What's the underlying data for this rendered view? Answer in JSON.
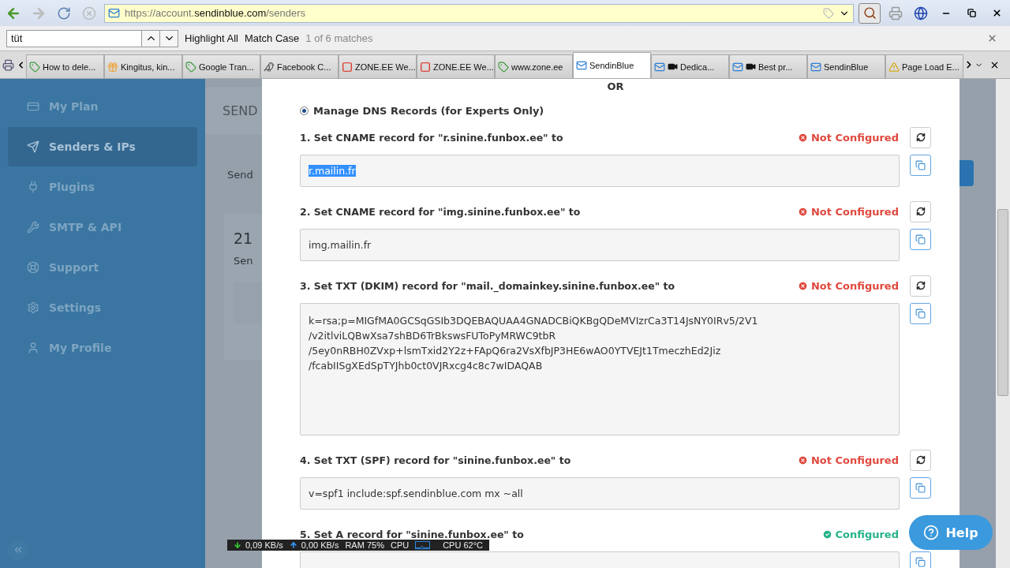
{
  "url": {
    "prefix": "https://account.",
    "domain": "sendinblue.com",
    "path": "/senders"
  },
  "find_bar": {
    "value": "tüt",
    "highlight_all": "Highlight All",
    "match_case": "Match Case",
    "result": "1 of 6 matches"
  },
  "tabs": [
    {
      "label": "How to dele...",
      "selected": false
    },
    {
      "label": "Kingitus, kin...",
      "selected": false
    },
    {
      "label": "Google Tran...",
      "selected": false
    },
    {
      "label": "Facebook C...",
      "selected": false
    },
    {
      "label": "ZONE.EE We...",
      "selected": false
    },
    {
      "label": "ZONE.EE We...",
      "selected": false
    },
    {
      "label": "www.zone.ee",
      "selected": false
    },
    {
      "label": "SendinBlue",
      "selected": true
    },
    {
      "label": "Dedica...",
      "selected": false
    },
    {
      "label": "Best pr...",
      "selected": false
    },
    {
      "label": "SendinBlue",
      "selected": false
    },
    {
      "label": "Page Load E...",
      "selected": false
    }
  ],
  "sidebar": {
    "items": [
      {
        "label": "My Plan",
        "selected": false
      },
      {
        "label": "Senders & IPs",
        "selected": true
      },
      {
        "label": "Plugins",
        "selected": false
      },
      {
        "label": "SMTP & API",
        "selected": false
      },
      {
        "label": "Support",
        "selected": false
      },
      {
        "label": "Settings",
        "selected": false
      },
      {
        "label": "My Profile",
        "selected": false
      }
    ]
  },
  "background": {
    "header": "SEND",
    "label": "Send",
    "count": "21",
    "caption": "Sen"
  },
  "modal": {
    "separator": "OR",
    "option": {
      "label": "Manage DNS Records (for Experts Only)",
      "selected": true
    },
    "records": [
      {
        "title": "1. Set CNAME record for \"r.sinine.funbox.ee\" to",
        "status": "Not Configured",
        "configured": false,
        "value": "r.mailin.fr",
        "value_selected": true,
        "kind": "line"
      },
      {
        "title": "2. Set CNAME record for \"img.sinine.funbox.ee\" to",
        "status": "Not Configured",
        "configured": false,
        "value": "img.mailin.fr",
        "value_selected": false,
        "kind": "line"
      },
      {
        "title": "3. Set TXT (DKIM) record for \"mail._domainkey.sinine.funbox.ee\" to",
        "status": "Not Configured",
        "configured": false,
        "value": "k=rsa;p=MIGfMA0GCSqGSIb3DQEBAQUAA4GNADCBiQKBgQDeMVIzrCa3T14JsNY0IRv5/2V1\n/v2itlviLQBwXsa7shBD6TrBkswsFUToPyMRWC9tbR\n/5ey0nRBH0ZVxp+lsmTxid2Y2z+FApQ6ra2VsXfbJP3HE6wAO0YTVEJt1TmeczhEd2Jiz\n/fcabIISgXEdSpTYJhb0ct0VJRxcg4c8c7wIDAQAB",
        "value_selected": false,
        "kind": "area"
      },
      {
        "title": "4. Set TXT (SPF) record for \"sinine.funbox.ee\" to",
        "status": "Not Configured",
        "configured": false,
        "value": "v=spf1 include:spf.sendinblue.com mx ~all",
        "value_selected": false,
        "kind": "line"
      },
      {
        "title": "5. Set A record for \"sinine.funbox.ee\" to",
        "status": "Configured",
        "configured": true,
        "kind": "line"
      }
    ]
  },
  "help_button": "Help",
  "net_meter": {
    "download": "0,09 KB/s",
    "upload": "0,00 KB/s",
    "ram": "RAM 75%",
    "cpu_label": "CPU",
    "cpu_temp": "CPU 62°C"
  }
}
